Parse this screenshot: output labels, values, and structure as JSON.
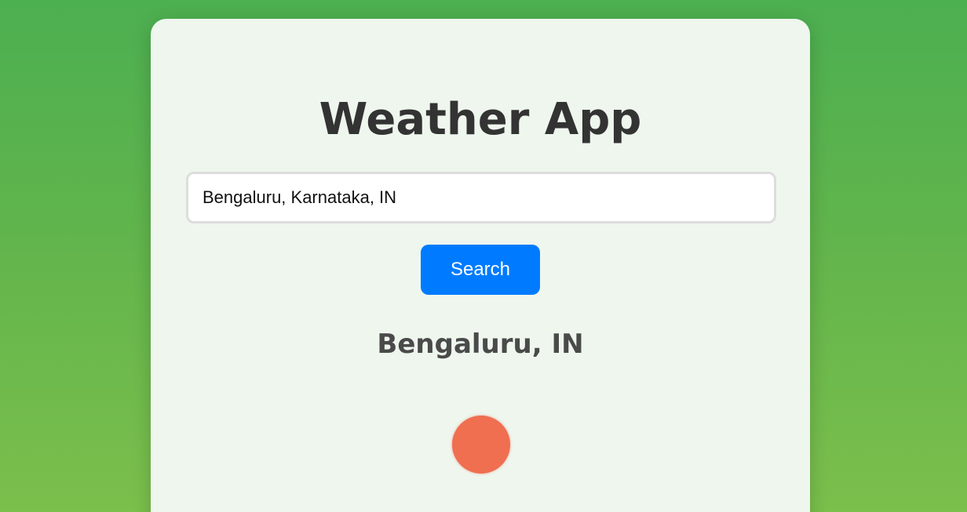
{
  "app": {
    "title": "Weather App"
  },
  "search": {
    "value": "Bengaluru, Karnataka, IN",
    "button_label": "Search"
  },
  "result": {
    "location": "Bengaluru, IN",
    "icon": "sun-icon",
    "icon_color": "#ef6f50"
  },
  "colors": {
    "background_top": "#4caf50",
    "background_bottom": "#7bbf4c",
    "card": "#eef6ee",
    "button": "#007bff",
    "title_text": "#333333"
  }
}
